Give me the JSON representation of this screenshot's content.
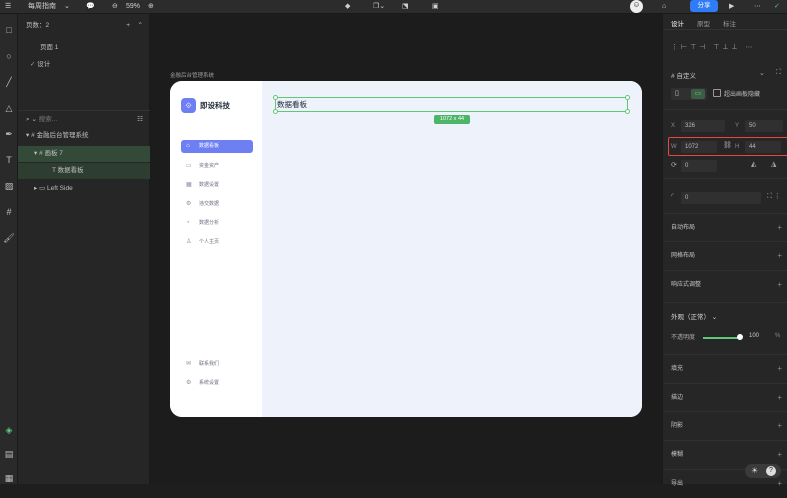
{
  "topbar": {
    "menu_label": "每周指南",
    "zoom": "59%",
    "share_label": "分享"
  },
  "layers_panel": {
    "pages_header": "页数：2",
    "pages": [
      "页面 1",
      "设计"
    ],
    "search_placeholder": "搜索...",
    "tree": [
      {
        "label": "金融后台管理系统"
      },
      {
        "label": "画板 7"
      },
      {
        "label": "数据看板"
      },
      {
        "label": "Left Side"
      }
    ]
  },
  "canvas": {
    "frame_label": "金融后台管理系统",
    "size_badge": "1072 x 44"
  },
  "artboard": {
    "brand": "即设科技",
    "header_title": "数据看板",
    "nav": [
      {
        "label": "数据看板",
        "icon": "home-icon",
        "active": true
      },
      {
        "label": "资金资产",
        "icon": "wallet-icon"
      },
      {
        "label": "数据设置",
        "icon": "calendar-icon"
      },
      {
        "label": "违交数据",
        "icon": "settings-icon"
      },
      {
        "label": "数据分析",
        "icon": "chart-icon"
      },
      {
        "label": "个人主页",
        "icon": "user-icon"
      }
    ],
    "bottom_nav": [
      {
        "label": "联系我们",
        "icon": "message-icon"
      },
      {
        "label": "系统设置",
        "icon": "gear-icon"
      }
    ]
  },
  "right_panel": {
    "tabs": [
      "设计",
      "原型",
      "标注"
    ],
    "frame_type": "自定义",
    "clip_label": "超出画板隐藏",
    "x_label": "X",
    "x_value": "326",
    "y_label": "Y",
    "y_value": "50",
    "w_label": "W",
    "w_value": "1072",
    "h_label": "H",
    "h_value": "44",
    "rotation": "0",
    "radius": "0",
    "sections": [
      "自动布局",
      "网格布局",
      "响应式调整"
    ],
    "appearance_label": "外观（正常）",
    "opacity_label": "不透明度",
    "opacity_value": "100",
    "opacity_unit": "%",
    "sections2": [
      "填充",
      "描边",
      "阴影",
      "模糊",
      "导出"
    ]
  },
  "colors": {
    "accent": "#2f7cf6",
    "selection": "#5fc778",
    "nav_active": "#6e7ff3",
    "highlight_border": "#e5483f"
  }
}
